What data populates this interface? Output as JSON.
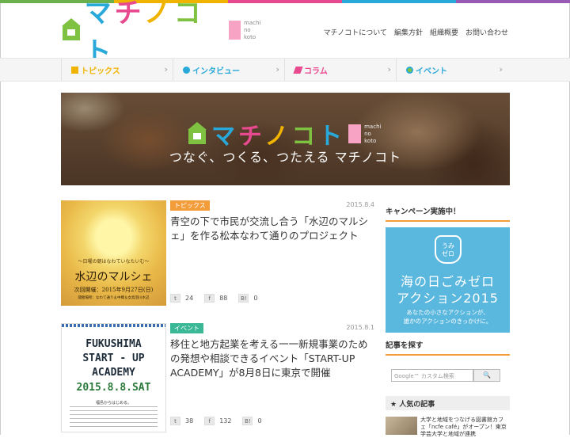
{
  "site": {
    "logo_text": [
      "マ",
      "チ",
      "ノ",
      "コ",
      "ト"
    ],
    "logo_sub": [
      "machi",
      "no",
      "koto"
    ]
  },
  "header_links": [
    "マチノコトについて",
    "編集方針",
    "組織概要",
    "お問い合わせ"
  ],
  "nav": [
    {
      "label": "トピックス",
      "color": "#f0b400",
      "icon": "stack-icon"
    },
    {
      "label": "インタビュー",
      "color": "#29a9d9",
      "icon": "microphone-icon"
    },
    {
      "label": "コラム",
      "color": "#e84a8f",
      "icon": "pencil-icon"
    },
    {
      "label": "イベント",
      "color": "#29a9d9",
      "icon": "globe-icon"
    }
  ],
  "hero": {
    "tagline": "つなぐ、つくる、つたえる マチノコト"
  },
  "articles": [
    {
      "badge": "トピックス",
      "badge_color": "#f39c3a",
      "date": "2015.8.4",
      "title": "青空の下で市民が交流し合う「水辺のマルシェ」を作る松本なわて通りのプロジェクト",
      "thumb": {
        "line1": "〜日曜の朝はなわていなたいむ〜",
        "line2": "水辺のマルシェ",
        "line3": "次回開催：2015年9月27日(日)",
        "line4": "開催場所：なわて通り＆中橋＆女鳥羽川水辺"
      },
      "social": [
        {
          "icon": "t",
          "count": "24"
        },
        {
          "icon": "f",
          "count": "88"
        },
        {
          "icon": "B!",
          "count": "0"
        }
      ]
    },
    {
      "badge": "イベント",
      "badge_color": "#3ab795",
      "date": "2015.8.1",
      "title": "移住と地方起業を考える一一新規事業のための発想や相談できるイベント「START-UP ACADEMY」が8月8日に東京で開催",
      "thumb": {
        "line1": "FUKUSHIMA",
        "line2": "START - UP",
        "line3": "ACADEMY",
        "line4": "2015.8.8.SAT",
        "line5": "福島からはじめる。"
      },
      "social": [
        {
          "icon": "t",
          "count": "38"
        },
        {
          "icon": "f",
          "count": "132"
        },
        {
          "icon": "B!",
          "count": "0"
        }
      ]
    }
  ],
  "sidebar": {
    "campaign_heading": "キャンペーン実施中！",
    "campaign": {
      "badge_line1": "うみ",
      "badge_line2": "ゼロ",
      "title1": "海の日ごみゼロ",
      "title2": "アクション2015",
      "sub1": "あなたの小さなアクションが、",
      "sub2": "誰かのアクションのきっかけに。"
    },
    "search_heading": "記事を探す",
    "search_placeholder": "Google™ カスタム検索",
    "search_button": "🔍",
    "popular_heading": "★ 人気の記事",
    "popular_item": "大学と地域をつなげる図書館カフェ「ncfe café」がオープン！東京学芸大学と地域が連携"
  }
}
